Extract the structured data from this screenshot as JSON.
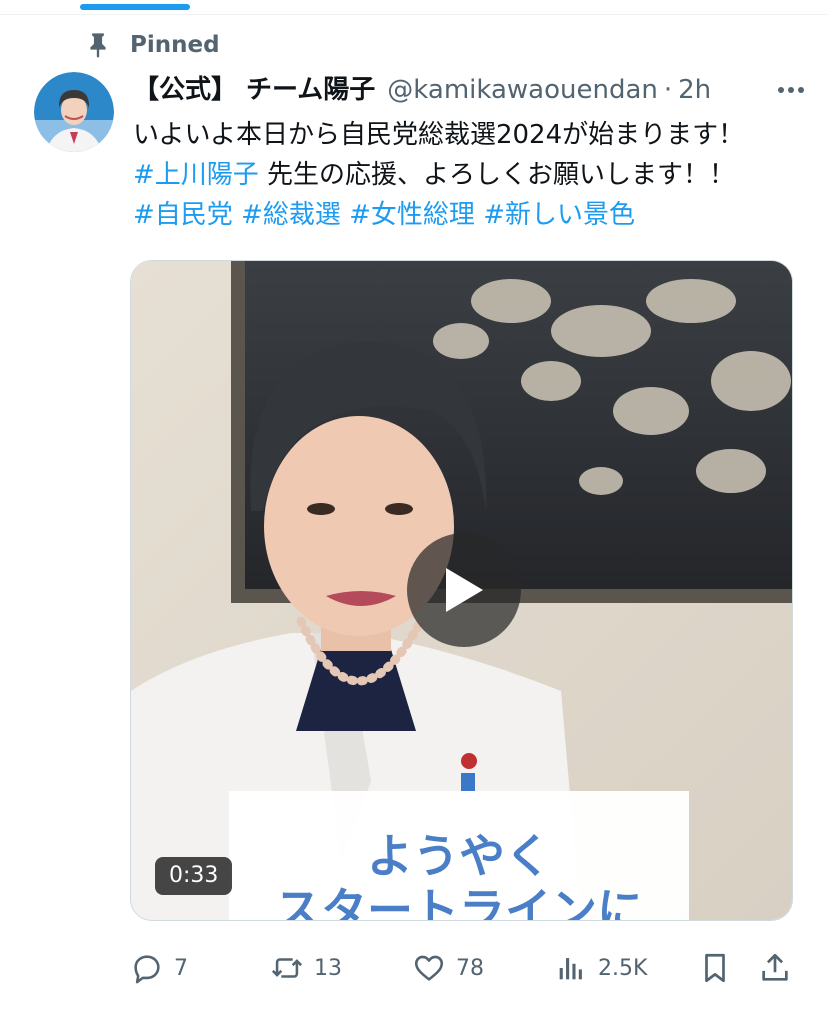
{
  "pinned_label": "Pinned",
  "tweet": {
    "display_name": "【公式】 チーム陽子",
    "handle": "@kamikawaouendan",
    "separator": "·",
    "time": "2h",
    "text_line1": "いよいよ本日から自民党総裁選2024が始まります！",
    "hashtag_main": "#上川陽子",
    "text_line2_rest": " 先生の応援、よろしくお願いします！！",
    "hashtags": [
      "#自民党",
      "#総裁選",
      "#女性総理",
      "#新しい景色"
    ]
  },
  "media": {
    "duration": "0:33",
    "caption_line1": "ようやく",
    "caption_line2": "スタートラインに"
  },
  "actions": {
    "replies": "7",
    "reposts": "13",
    "likes": "78",
    "views": "2.5K"
  },
  "colors": {
    "accent": "#1d9bf0",
    "secondary_text": "#536471",
    "caption": "#4a7fc8"
  },
  "icons": [
    "pin-icon",
    "more-icon",
    "play-icon",
    "reply-icon",
    "repost-icon",
    "like-icon",
    "views-icon",
    "bookmark-icon",
    "share-icon"
  ]
}
